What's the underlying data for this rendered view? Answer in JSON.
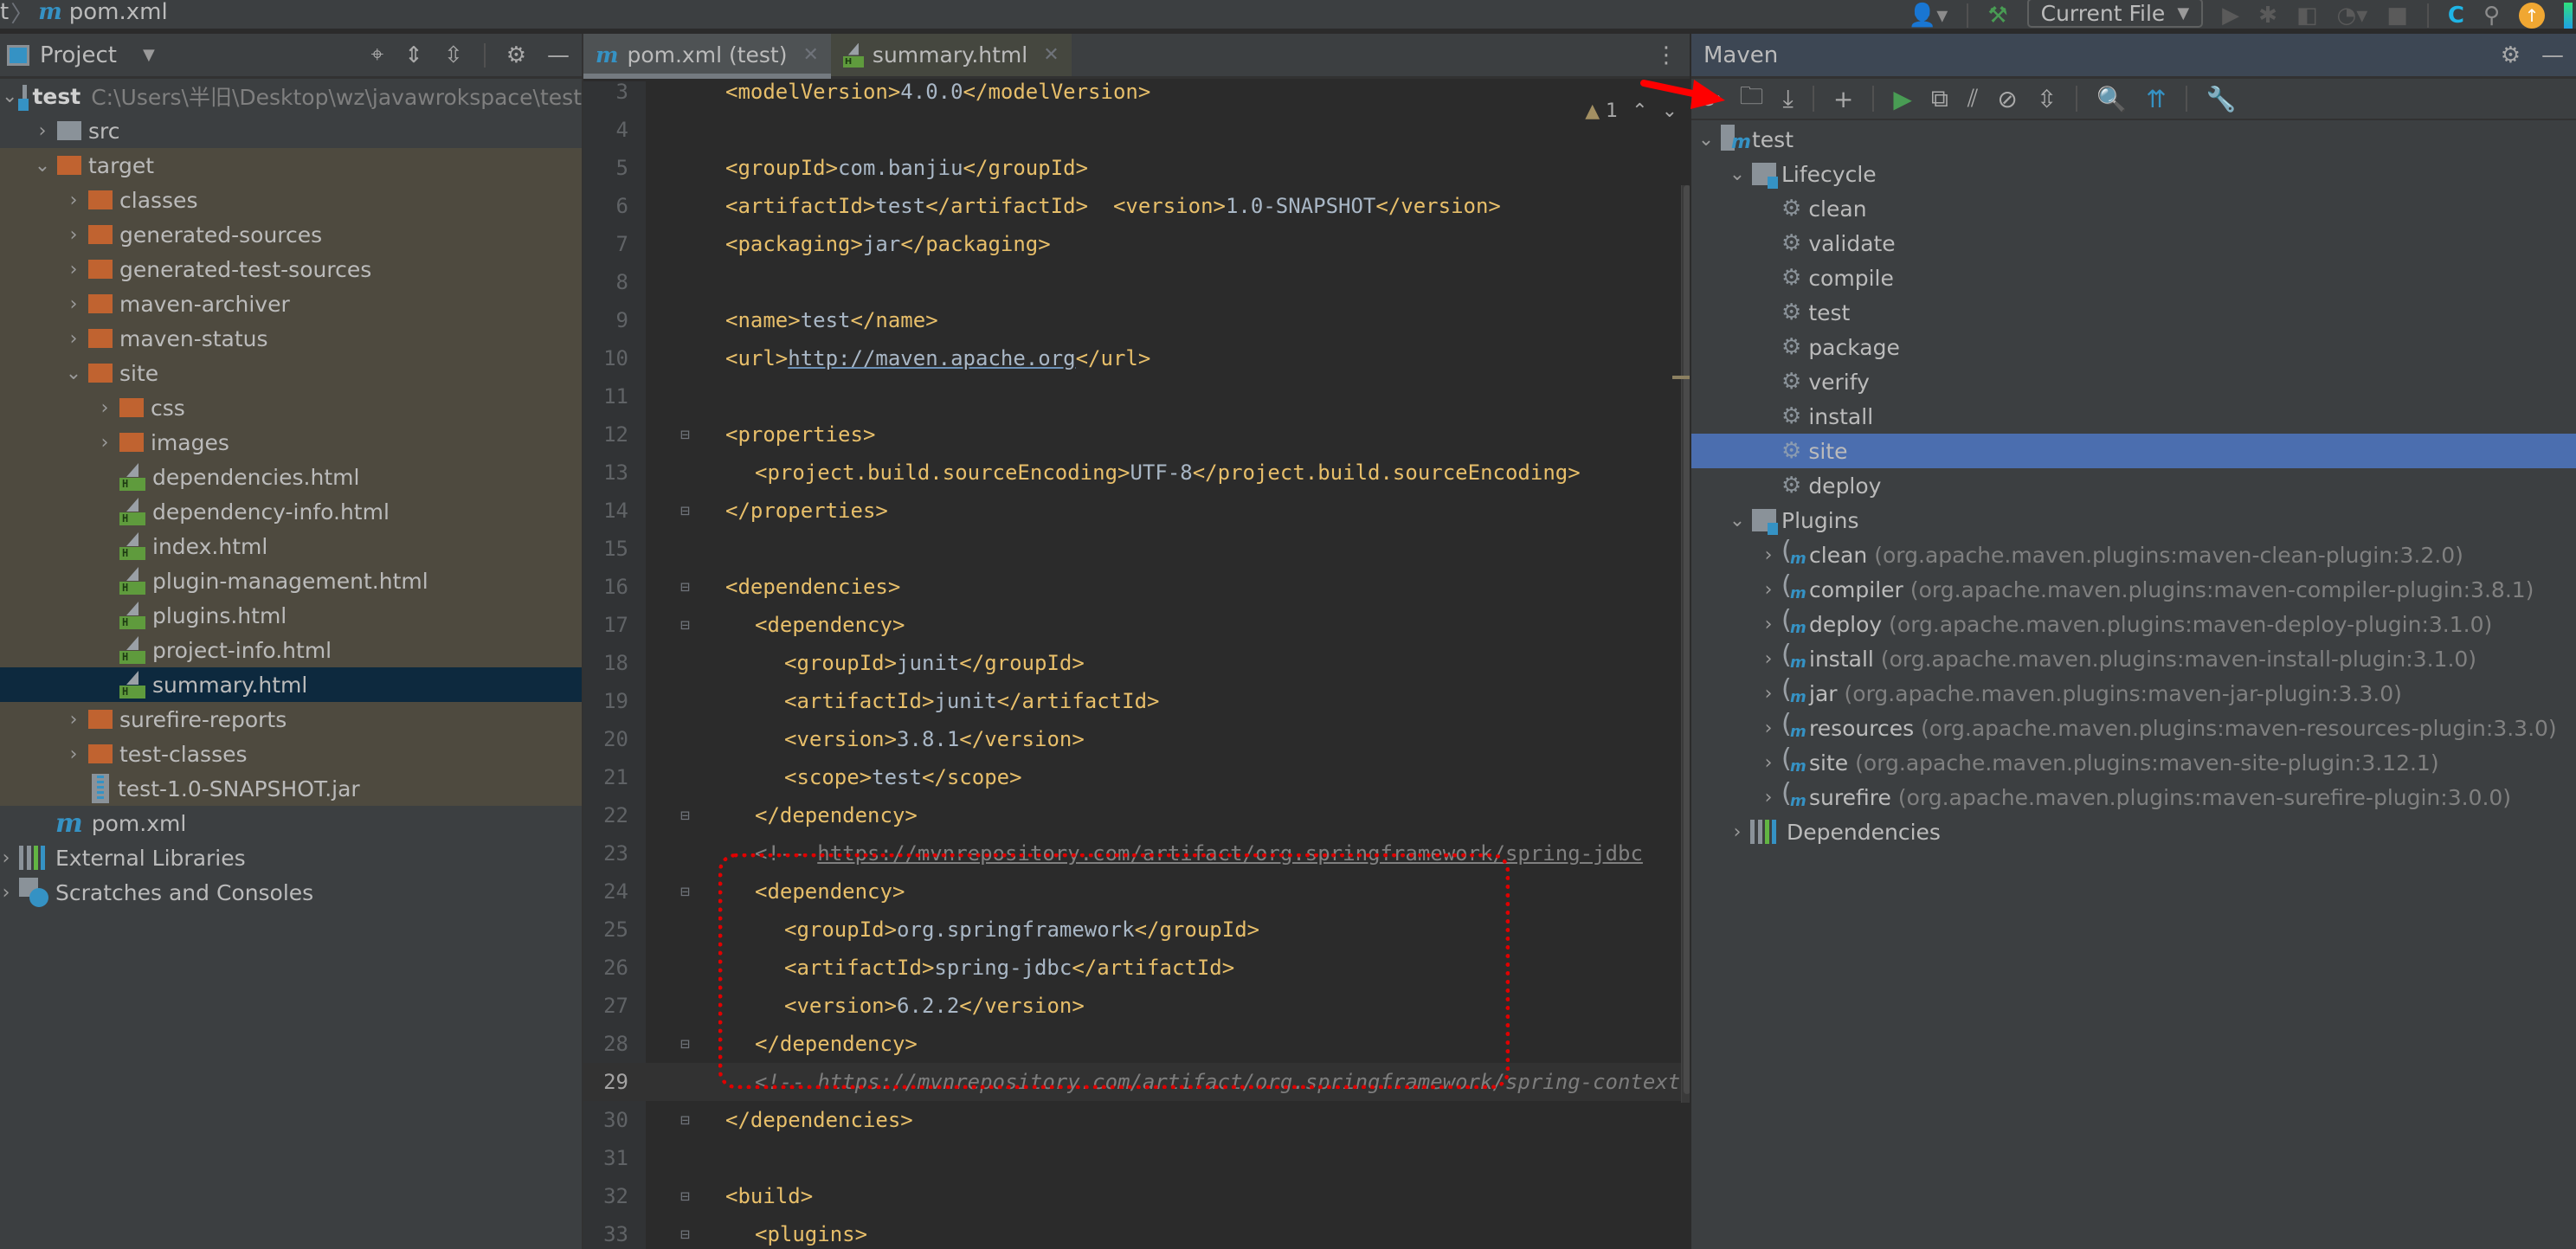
{
  "topbar": {
    "breadcrumb_prefix": "t",
    "breadcrumb_file": "pom.xml",
    "run_config": "Current File",
    "icons": [
      "user-icon",
      "build-hammer-icon",
      "run-icon",
      "debug-icon",
      "coverage-icon",
      "profile-icon",
      "stop-icon",
      "ide-logo-icon",
      "search-icon",
      "update-icon"
    ]
  },
  "project": {
    "title": "Project",
    "tree": [
      {
        "label": "test",
        "path": "C:\\Users\\半旧\\Desktop\\wz\\javawrokspace\\test",
        "type": "module",
        "level": 0,
        "expanded": true
      },
      {
        "label": "src",
        "type": "folder-gray",
        "level": 1,
        "expanded": false
      },
      {
        "label": "target",
        "type": "folder-orange",
        "level": 1,
        "expanded": true,
        "excluded": true
      },
      {
        "label": "classes",
        "type": "folder-orange",
        "level": 2,
        "expanded": false,
        "excluded": true
      },
      {
        "label": "generated-sources",
        "type": "folder-orange",
        "level": 2,
        "expanded": false,
        "excluded": true
      },
      {
        "label": "generated-test-sources",
        "type": "folder-orange",
        "level": 2,
        "expanded": false,
        "excluded": true
      },
      {
        "label": "maven-archiver",
        "type": "folder-orange",
        "level": 2,
        "expanded": false,
        "excluded": true
      },
      {
        "label": "maven-status",
        "type": "folder-orange",
        "level": 2,
        "expanded": false,
        "excluded": true
      },
      {
        "label": "site",
        "type": "folder-orange",
        "level": 2,
        "expanded": true,
        "excluded": true
      },
      {
        "label": "css",
        "type": "folder-orange",
        "level": 3,
        "expanded": false,
        "excluded": true
      },
      {
        "label": "images",
        "type": "folder-orange",
        "level": 3,
        "expanded": false,
        "excluded": true
      },
      {
        "label": "dependencies.html",
        "type": "html",
        "level": 3,
        "excluded": true
      },
      {
        "label": "dependency-info.html",
        "type": "html",
        "level": 3,
        "excluded": true
      },
      {
        "label": "index.html",
        "type": "html",
        "level": 3,
        "excluded": true
      },
      {
        "label": "plugin-management.html",
        "type": "html",
        "level": 3,
        "excluded": true
      },
      {
        "label": "plugins.html",
        "type": "html",
        "level": 3,
        "excluded": true
      },
      {
        "label": "project-info.html",
        "type": "html",
        "level": 3,
        "excluded": true
      },
      {
        "label": "summary.html",
        "type": "html",
        "level": 3,
        "selected": true
      },
      {
        "label": "surefire-reports",
        "type": "folder-orange",
        "level": 2,
        "expanded": false,
        "excluded": true
      },
      {
        "label": "test-classes",
        "type": "folder-orange",
        "level": 2,
        "expanded": false,
        "excluded": true
      },
      {
        "label": "test-1.0-SNAPSHOT.jar",
        "type": "jar",
        "level": 2,
        "excluded": true
      },
      {
        "label": "pom.xml",
        "type": "maven",
        "level": 1
      },
      {
        "label": "External Libraries",
        "type": "libraries",
        "level": 0,
        "expanded": false
      },
      {
        "label": "Scratches and Consoles",
        "type": "scratches",
        "level": 0,
        "expanded": false
      }
    ]
  },
  "editor": {
    "tabs": [
      {
        "label": "pom.xml (test)",
        "icon": "maven-icon",
        "active": true
      },
      {
        "label": "summary.html",
        "icon": "html-file-icon",
        "active": false
      }
    ],
    "warnings_count": "1",
    "current_line": 29,
    "lines": [
      {
        "n": "3",
        "indent": 0,
        "parts": [
          [
            "tag",
            "<modelVersion>"
          ],
          [
            "txt",
            "4.0.0"
          ],
          [
            "tag",
            "</modelVersion>"
          ]
        ]
      },
      {
        "n": "4",
        "indent": 0,
        "parts": []
      },
      {
        "n": "5",
        "indent": 0,
        "parts": [
          [
            "tag",
            "<groupId>"
          ],
          [
            "txt",
            "com.banjiu"
          ],
          [
            "tag",
            "</groupId>"
          ]
        ]
      },
      {
        "n": "6",
        "indent": 0,
        "parts": [
          [
            "tag",
            "<artifactId>"
          ],
          [
            "txt",
            "test"
          ],
          [
            "tag",
            "</artifactId>"
          ],
          [
            "txt",
            "  "
          ],
          [
            "tag",
            "<version>"
          ],
          [
            "txt",
            "1.0-SNAPSHOT"
          ],
          [
            "tag",
            "</version>"
          ]
        ]
      },
      {
        "n": "7",
        "indent": 0,
        "parts": [
          [
            "tag",
            "<packaging>"
          ],
          [
            "txt",
            "jar"
          ],
          [
            "tag",
            "</packaging>"
          ]
        ]
      },
      {
        "n": "8",
        "indent": 0,
        "parts": []
      },
      {
        "n": "9",
        "indent": 0,
        "parts": [
          [
            "tag",
            "<name>"
          ],
          [
            "txt",
            "test"
          ],
          [
            "tag",
            "</name>"
          ]
        ]
      },
      {
        "n": "10",
        "indent": 0,
        "parts": [
          [
            "tag",
            "<url>"
          ],
          [
            "link",
            "http://maven.apache.org"
          ],
          [
            "tag",
            "</url>"
          ]
        ]
      },
      {
        "n": "11",
        "indent": 0,
        "parts": []
      },
      {
        "n": "12",
        "indent": 0,
        "fold": "open",
        "parts": [
          [
            "tag",
            "<properties>"
          ]
        ]
      },
      {
        "n": "13",
        "indent": 1,
        "parts": [
          [
            "tag",
            "<project.build.sourceEncoding>"
          ],
          [
            "txt",
            "UTF-8"
          ],
          [
            "tag",
            "</project.build.sourceEncoding>"
          ]
        ]
      },
      {
        "n": "14",
        "indent": 0,
        "fold": "close",
        "parts": [
          [
            "tag",
            "</properties>"
          ]
        ]
      },
      {
        "n": "15",
        "indent": 0,
        "parts": []
      },
      {
        "n": "16",
        "indent": 0,
        "fold": "open",
        "parts": [
          [
            "tag",
            "<dependencies>"
          ]
        ]
      },
      {
        "n": "17",
        "indent": 1,
        "fold": "open",
        "parts": [
          [
            "tag",
            "<dependency>"
          ]
        ]
      },
      {
        "n": "18",
        "indent": 2,
        "parts": [
          [
            "tag",
            "<groupId>"
          ],
          [
            "txt",
            "junit"
          ],
          [
            "tag",
            "</groupId>"
          ]
        ]
      },
      {
        "n": "19",
        "indent": 2,
        "parts": [
          [
            "tag",
            "<artifactId>"
          ],
          [
            "txt",
            "junit"
          ],
          [
            "tag",
            "</artifactId>"
          ]
        ]
      },
      {
        "n": "20",
        "indent": 2,
        "parts": [
          [
            "tag",
            "<version>"
          ],
          [
            "txt",
            "3.8.1"
          ],
          [
            "tag",
            "</version>"
          ]
        ]
      },
      {
        "n": "21",
        "indent": 2,
        "parts": [
          [
            "tag",
            "<scope>"
          ],
          [
            "txt",
            "test"
          ],
          [
            "tag",
            "</scope>"
          ]
        ]
      },
      {
        "n": "22",
        "indent": 1,
        "fold": "close",
        "parts": [
          [
            "tag",
            "</dependency>"
          ]
        ]
      },
      {
        "n": "23",
        "indent": 1,
        "parts": [
          [
            "cmt",
            "<!-- "
          ],
          [
            "url",
            "https://mvnrepository.com/artifact/org.springframework/spring-jdbc"
          ]
        ]
      },
      {
        "n": "24",
        "indent": 1,
        "fold": "open",
        "parts": [
          [
            "tag",
            "<dependency>"
          ]
        ]
      },
      {
        "n": "25",
        "indent": 2,
        "parts": [
          [
            "tag",
            "<groupId>"
          ],
          [
            "txt",
            "org.springframework"
          ],
          [
            "tag",
            "</groupId>"
          ]
        ]
      },
      {
        "n": "26",
        "indent": 2,
        "parts": [
          [
            "tag",
            "<artifactId>"
          ],
          [
            "txt",
            "spring-jdbc"
          ],
          [
            "tag",
            "</artifactId>"
          ]
        ]
      },
      {
        "n": "27",
        "indent": 2,
        "parts": [
          [
            "tag",
            "<version>"
          ],
          [
            "txt",
            "6.2.2"
          ],
          [
            "tag",
            "</version>"
          ]
        ]
      },
      {
        "n": "28",
        "indent": 1,
        "fold": "close",
        "parts": [
          [
            "tag",
            "</dependency>"
          ]
        ]
      },
      {
        "n": "29",
        "indent": 1,
        "parts": [
          [
            "cmtit",
            "<!-- https://mvnrepository.com/artifact/org.springframework/spring-context"
          ]
        ]
      },
      {
        "n": "30",
        "indent": 0,
        "fold": "close",
        "parts": [
          [
            "tag",
            "</dependencies>"
          ]
        ]
      },
      {
        "n": "31",
        "indent": 0,
        "parts": []
      },
      {
        "n": "32",
        "indent": 0,
        "fold": "open",
        "parts": [
          [
            "tag",
            "<build>"
          ]
        ]
      },
      {
        "n": "33",
        "indent": 1,
        "fold": "open",
        "parts": [
          [
            "tag",
            "<plugins>"
          ]
        ]
      }
    ]
  },
  "maven": {
    "title": "Maven",
    "toolbar": [
      "reload-all-projects-icon",
      "generate-sources-icon",
      "download-sources-icon",
      "add-project-icon",
      "run-maven-build-icon",
      "execute-goal-icon",
      "toggle-offline-icon",
      "skip-tests-icon",
      "collapse-all-icon",
      "analyze-dependencies-icon",
      "show-diagram-icon",
      "build-settings-icon"
    ],
    "project": "test",
    "lifecycle_label": "Lifecycle",
    "lifecycle": [
      "clean",
      "validate",
      "compile",
      "test",
      "package",
      "verify",
      "install",
      "site",
      "deploy"
    ],
    "selected_lifecycle": "site",
    "plugins_label": "Plugins",
    "plugins": [
      {
        "name": "clean",
        "coord": "(org.apache.maven.plugins:maven-clean-plugin:3.2.0)"
      },
      {
        "name": "compiler",
        "coord": "(org.apache.maven.plugins:maven-compiler-plugin:3.8.1)"
      },
      {
        "name": "deploy",
        "coord": "(org.apache.maven.plugins:maven-deploy-plugin:3.1.0)"
      },
      {
        "name": "install",
        "coord": "(org.apache.maven.plugins:maven-install-plugin:3.1.0)"
      },
      {
        "name": "jar",
        "coord": "(org.apache.maven.plugins:maven-jar-plugin:3.3.0)"
      },
      {
        "name": "resources",
        "coord": "(org.apache.maven.plugins:maven-resources-plugin:3.3.0)"
      },
      {
        "name": "site",
        "coord": "(org.apache.maven.plugins:maven-site-plugin:3.12.1)"
      },
      {
        "name": "surefire",
        "coord": "(org.apache.maven.plugins:maven-surefire-plugin:3.0.0)"
      }
    ],
    "dependencies_label": "Dependencies"
  },
  "annotations": {
    "highlight_color": "#e00000"
  }
}
